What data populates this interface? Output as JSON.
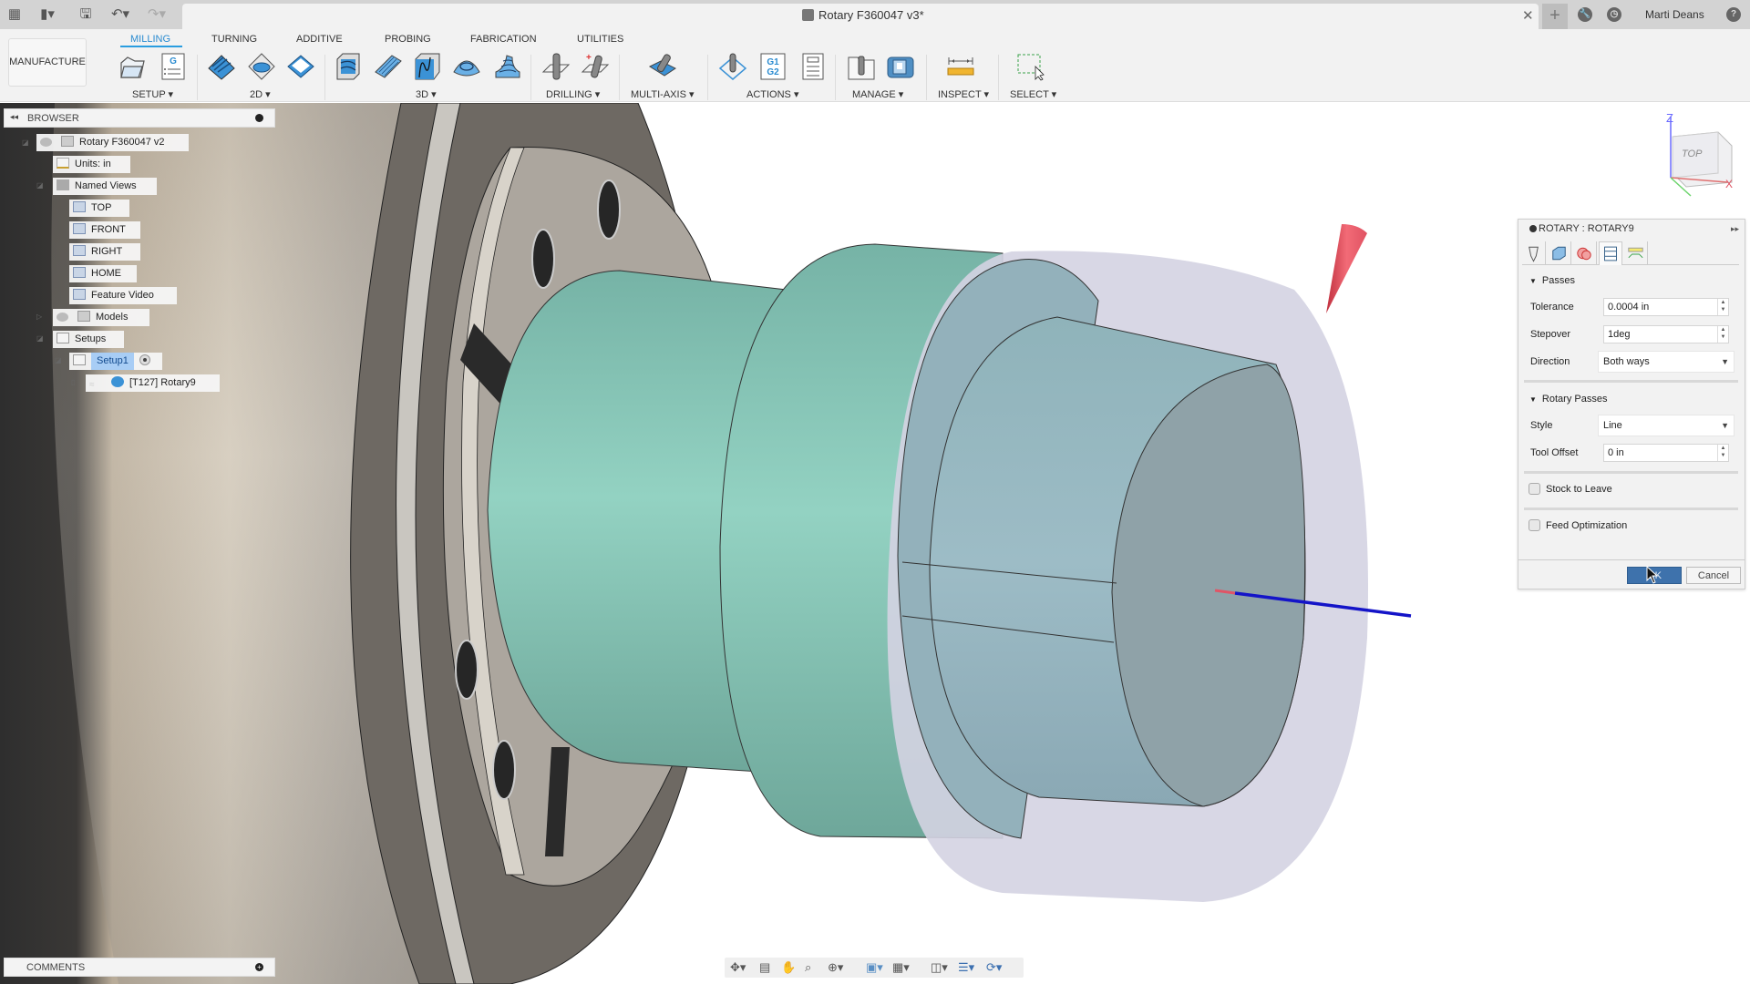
{
  "app": {
    "document_title": "Rotary F360047 v3*",
    "user_name": "Marti Deans"
  },
  "ribbon": {
    "workspace": "MANUFACTURE",
    "tabs": [
      {
        "label": "MILLING",
        "active": true
      },
      {
        "label": "TURNING",
        "active": false
      },
      {
        "label": "ADDITIVE",
        "active": false
      },
      {
        "label": "PROBING",
        "active": false
      },
      {
        "label": "FABRICATION",
        "active": false
      },
      {
        "label": "UTILITIES",
        "active": false
      }
    ],
    "groups": [
      {
        "label": "SETUP",
        "tools": [
          "setup-icon",
          "nc-program-icon"
        ]
      },
      {
        "label": "2D",
        "tools": [
          "2d-adaptive-icon",
          "2d-pocket-icon",
          "face-icon"
        ]
      },
      {
        "label": "3D",
        "tools": [
          "3d-adaptive-icon",
          "parallel-icon",
          "contour-icon",
          "scallop-icon",
          "spiral-icon"
        ]
      },
      {
        "label": "DRILLING",
        "tools": [
          "drill-icon",
          "hole-recognition-icon"
        ]
      },
      {
        "label": "MULTI-AXIS",
        "tools": [
          "multi-axis-icon"
        ]
      },
      {
        "label": "ACTIONS",
        "tools": [
          "simulate-icon",
          "post-process-icon",
          "setup-sheet-icon"
        ]
      },
      {
        "label": "MANAGE",
        "tools": [
          "tool-library-icon",
          "machine-library-icon"
        ]
      },
      {
        "label": "INSPECT",
        "tools": [
          "measure-icon"
        ]
      },
      {
        "label": "SELECT",
        "tools": [
          "window-select-icon"
        ]
      }
    ]
  },
  "browser": {
    "title": "BROWSER",
    "items": [
      {
        "label": "Rotary F360047 v2",
        "level": 0
      },
      {
        "label": "Units: in",
        "level": 1
      },
      {
        "label": "Named Views",
        "level": 1
      },
      {
        "label": "TOP",
        "level": 2
      },
      {
        "label": "FRONT",
        "level": 2
      },
      {
        "label": "RIGHT",
        "level": 2
      },
      {
        "label": "HOME",
        "level": 2
      },
      {
        "label": "Feature Video",
        "level": 2
      },
      {
        "label": "Models",
        "level": 1
      },
      {
        "label": "Setups",
        "level": 1
      },
      {
        "label": "Setup1",
        "level": 2,
        "selected": true
      },
      {
        "label": "[T127] Rotary9",
        "level": 3
      }
    ]
  },
  "comments": {
    "title": "COMMENTS"
  },
  "viewcube": {
    "face_label": "TOP",
    "axes": {
      "z": "Z",
      "x": "X"
    }
  },
  "dialog": {
    "title": "ROTARY : ROTARY9",
    "tabs": [
      "tool-tab",
      "geometry-tab",
      "heights-tab",
      "passes-tab",
      "linking-tab"
    ],
    "active_tab": 3,
    "passes": {
      "header": "Passes",
      "tolerance_label": "Tolerance",
      "tolerance_value": "0.0004 in",
      "stepover_label": "Stepover",
      "stepover_value": "1deg",
      "direction_label": "Direction",
      "direction_value": "Both ways"
    },
    "rotary_passes": {
      "header": "Rotary Passes",
      "style_label": "Style",
      "style_value": "Line",
      "tool_offset_label": "Tool Offset",
      "tool_offset_value": "0 in"
    },
    "stock_to_leave": {
      "label": "Stock to Leave",
      "checked": false
    },
    "feed_optimization": {
      "label": "Feed Optimization",
      "checked": false
    },
    "ok_label": "OK",
    "cancel_label": "Cancel"
  },
  "colors": {
    "accent": "#2a8bd0",
    "part_teal": "#8fcfc0",
    "stock_lavender": "#d4d3e2",
    "ok_button": "#3e72ac"
  }
}
